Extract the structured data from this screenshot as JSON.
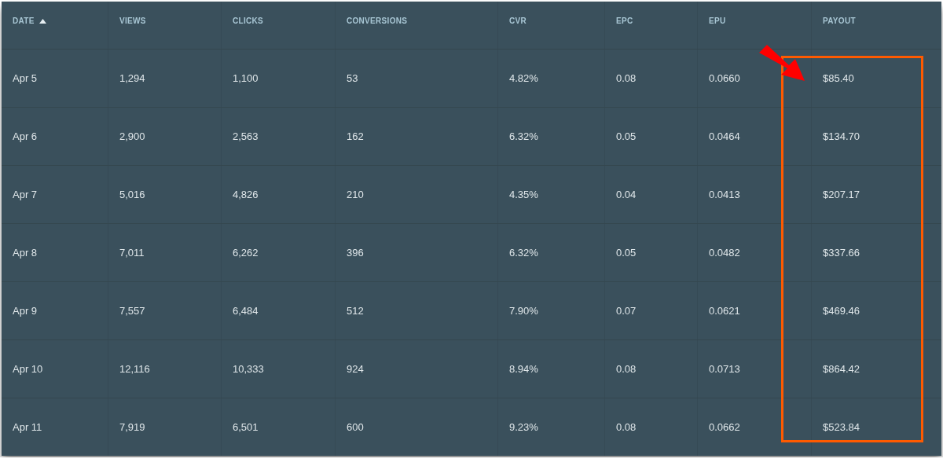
{
  "table": {
    "columns": [
      {
        "label": "DATE",
        "sorted": true,
        "highlighted": false
      },
      {
        "label": "VIEWS",
        "sorted": false,
        "highlighted": false
      },
      {
        "label": "CLICKS",
        "sorted": false,
        "highlighted": false
      },
      {
        "label": "CONVERSIONS",
        "sorted": false,
        "highlighted": false
      },
      {
        "label": "CVR",
        "sorted": false,
        "highlighted": false
      },
      {
        "label": "EPC",
        "sorted": false,
        "highlighted": false
      },
      {
        "label": "EPU",
        "sorted": false,
        "highlighted": false
      },
      {
        "label": "PAYOUT",
        "sorted": false,
        "highlighted": true
      }
    ],
    "rows": [
      [
        "Apr 5",
        "1,294",
        "1,100",
        "53",
        "4.82%",
        "0.08",
        "0.0660",
        "$85.40"
      ],
      [
        "Apr 6",
        "2,900",
        "2,563",
        "162",
        "6.32%",
        "0.05",
        "0.0464",
        "$134.70"
      ],
      [
        "Apr 7",
        "5,016",
        "4,826",
        "210",
        "4.35%",
        "0.04",
        "0.0413",
        "$207.17"
      ],
      [
        "Apr 8",
        "7,011",
        "6,262",
        "396",
        "6.32%",
        "0.05",
        "0.0482",
        "$337.66"
      ],
      [
        "Apr 9",
        "7,557",
        "6,484",
        "512",
        "7.90%",
        "0.07",
        "0.0621",
        "$469.46"
      ],
      [
        "Apr 10",
        "12,116",
        "10,333",
        "924",
        "8.94%",
        "0.08",
        "0.0713",
        "$864.42"
      ],
      [
        "Apr 11",
        "7,919",
        "6,501",
        "600",
        "9.23%",
        "0.08",
        "0.0662",
        "$523.84"
      ]
    ]
  }
}
